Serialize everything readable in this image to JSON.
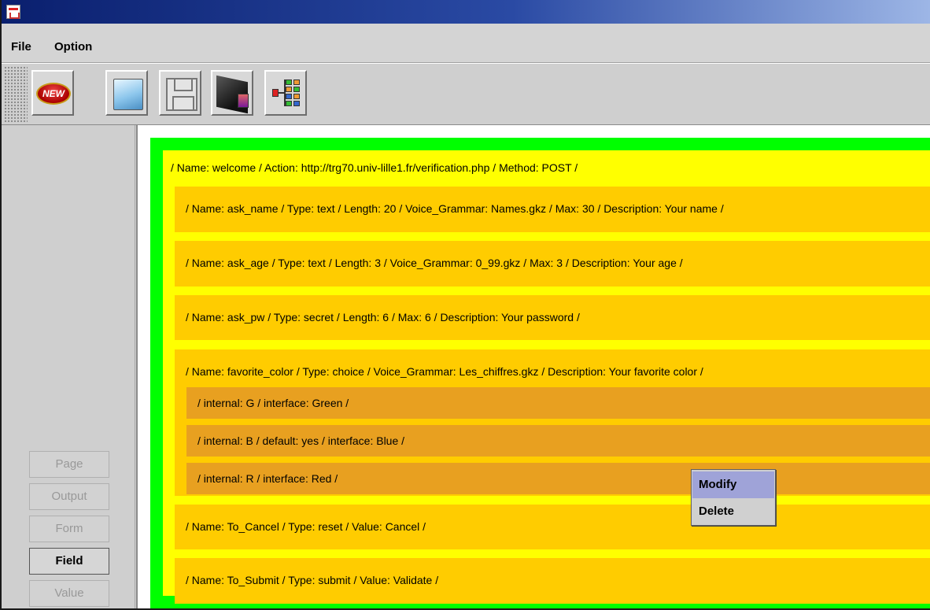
{
  "menubar": {
    "items": [
      "File",
      "Option"
    ]
  },
  "toolbar": {
    "new_label": "NEW",
    "buttons": [
      {
        "name": "new-button",
        "icon": "new-icon"
      },
      {
        "name": "open-button",
        "icon": "folder-icon"
      },
      {
        "name": "save-button",
        "icon": "floppy-disk-icon"
      },
      {
        "name": "preview-button",
        "icon": "camera-icon"
      },
      {
        "name": "tree-view-button",
        "icon": "tree-structure-icon"
      }
    ]
  },
  "sidebar": {
    "buttons": [
      {
        "label": "Page",
        "active": false
      },
      {
        "label": "Output",
        "active": false
      },
      {
        "label": "Form",
        "active": false
      },
      {
        "label": "Field",
        "active": true
      },
      {
        "label": "Value",
        "active": false
      }
    ]
  },
  "form": {
    "label": "/ Name: welcome / Action: http://trg70.univ-lille1.fr/verification.php / Method: POST /",
    "fields": [
      {
        "label": "/ Name: ask_name / Type: text / Length: 20 / Voice_Grammar: Names.gkz / Max: 30 / Description: Your name /"
      },
      {
        "label": "/ Name: ask_age / Type: text / Length: 3 / Voice_Grammar: 0_99.gkz / Max: 3 / Description: Your age /"
      },
      {
        "label": "/ Name: ask_pw / Type: secret / Length: 6 / Max: 6 / Description: Your password /"
      },
      {
        "label": "/ Name: favorite_color / Type: choice / Voice_Grammar: Les_chiffres.gkz / Description: Your favorite color /",
        "values": [
          "/ internal: G / interface: Green /",
          "/ internal: B / default: yes / interface: Blue /",
          "/ internal: R / interface: Red /"
        ]
      },
      {
        "label": "/ Name: To_Cancel / Type: reset / Value: Cancel /"
      },
      {
        "label": "/ Name: To_Submit / Type: submit / Value: Validate /"
      }
    ]
  },
  "context_menu": {
    "items": [
      "Modify",
      "Delete"
    ],
    "highlighted": "Modify"
  },
  "colors": {
    "page": "#00ff00",
    "form": "#ffff00",
    "field": "#ffcc00",
    "value": "#e8a020",
    "menu_highlight": "#9fa3d8"
  }
}
